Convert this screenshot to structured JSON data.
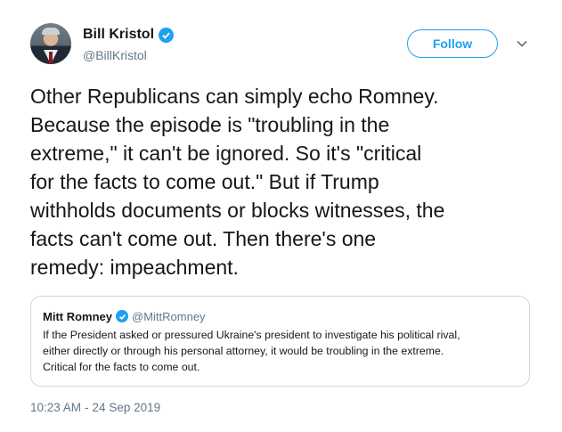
{
  "author": {
    "display_name": "Bill Kristol",
    "handle": "@BillKristol",
    "verified": true
  },
  "follow_button": {
    "label": "Follow"
  },
  "tweet": {
    "lines": [
      "Other Republicans can simply echo Romney.",
      "Because the episode is \"troubling in the",
      "extreme,\" it can't be ignored. So it's \"critical",
      "for the facts to come out.\" But if Trump",
      "withholds documents or blocks witnesses, the",
      "facts can't come out. Then there's one",
      "remedy: impeachment."
    ]
  },
  "quoted_tweet": {
    "display_name": "Mitt Romney",
    "handle": "@MittRomney",
    "verified": true,
    "lines": [
      "If the President asked or pressured Ukraine's president to investigate his political rival,",
      "either directly or through his personal attorney, it would be troubling in the extreme.",
      "Critical for the facts to come out."
    ]
  },
  "timestamp": {
    "time": "10:23 AM",
    "date": "24 Sep 2019"
  },
  "colors": {
    "accent": "#1da1f2",
    "text": "#14171a",
    "secondary": "#657786",
    "border": "#ccd6dd"
  },
  "icons": {
    "verified": "verified-badge-icon",
    "menu": "chevron-down-icon",
    "avatar": "profile-photo"
  }
}
